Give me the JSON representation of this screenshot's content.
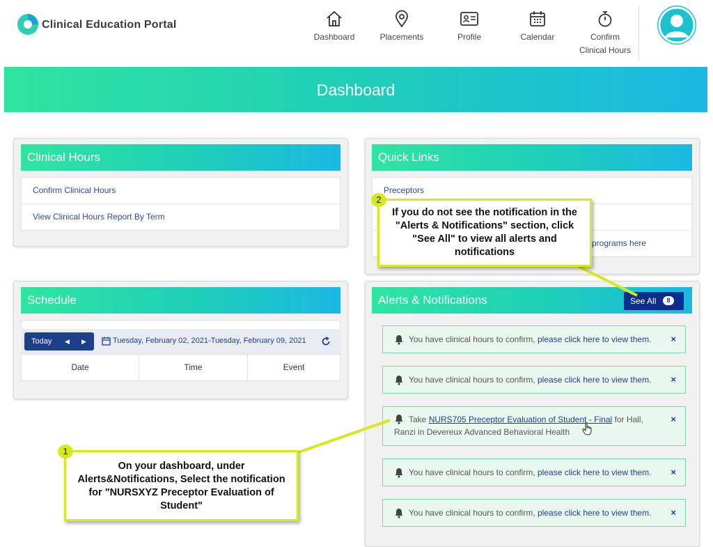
{
  "header": {
    "app_title": "Clinical Education Portal",
    "nav": [
      {
        "label": "Dashboard",
        "icon": "home-icon"
      },
      {
        "label": "Placements",
        "icon": "location-pin-icon"
      },
      {
        "label": "Profile",
        "icon": "id-card-icon"
      },
      {
        "label": "Calendar",
        "icon": "calendar-icon"
      },
      {
        "label": "Confirm",
        "label2": "Clinical Hours",
        "icon": "stopwatch-icon"
      }
    ]
  },
  "banner": {
    "title": "Dashboard"
  },
  "clinical_hours": {
    "title": "Clinical Hours",
    "links": [
      "Confirm Clinical Hours",
      "View Clinical Hours Report By Term"
    ]
  },
  "quick_links": {
    "title": "Quick Links",
    "links": [
      "Preceptors",
      "programs here"
    ]
  },
  "schedule": {
    "title": "Schedule",
    "today_label": "Today",
    "date_range": "Tuesday, February 02, 2021-Tuesday, February 09, 2021",
    "columns": [
      "Date",
      "Time",
      "Event"
    ]
  },
  "alerts": {
    "title": "Alerts & Notifications",
    "see_all_label": "See All",
    "see_all_count": "8",
    "items": [
      {
        "prefix": "You have clinical hours to confirm, ",
        "link": "please click here to view them."
      },
      {
        "prefix": "You have clinical hours to confirm, ",
        "link": "please click here to view them."
      },
      {
        "prefix": "Take ",
        "link": "NURS705 Preceptor Evaluation of Student - Final",
        "suffix": " for Hall,",
        "line2": "Ranzi in Devereux Advanced Behavioral Health"
      },
      {
        "prefix": "You have clinical hours to confirm, ",
        "link": "please click here to view them."
      },
      {
        "prefix": "You have clinical hours to confirm, ",
        "link": "please click here to view them."
      }
    ],
    "close_glyph": "×"
  },
  "callouts": [
    {
      "number": "1",
      "text": "On your dashboard, under Alerts&Notifications, Select the notification for \"NURSXYZ Preceptor Evaluation of Student\""
    },
    {
      "number": "2",
      "text": "If you do not see the notification in the \"Alerts & Notifications\" section, click \"See All\" to view all alerts and notifications"
    }
  ],
  "colors": {
    "accent_green": "#2ee5a0",
    "accent_blue": "#1bb8e3",
    "navy": "#1d3e8a",
    "callout_yellow": "#d4ea1f"
  }
}
